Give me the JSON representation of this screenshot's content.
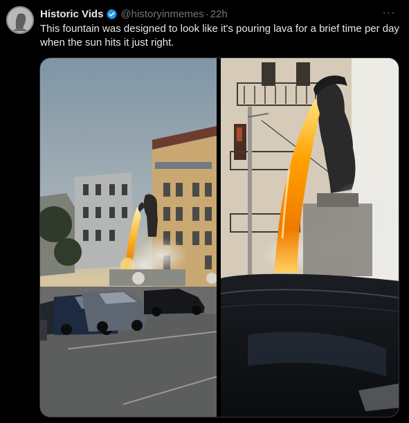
{
  "tweet": {
    "author_name": "Historic Vids",
    "handle": "@historyinmemes",
    "separator": "·",
    "time": "22h",
    "text": "This fountain was designed to look like it's pouring lava for a brief time per day when the sun hits it just right.",
    "more_label": "···"
  },
  "colors": {
    "background": "#000000",
    "text": "#e7e9ea",
    "muted": "#71767b",
    "verified": "#1d9bf0"
  },
  "icons": {
    "verified": "verified-badge-icon",
    "more": "more-horizontal-icon"
  }
}
